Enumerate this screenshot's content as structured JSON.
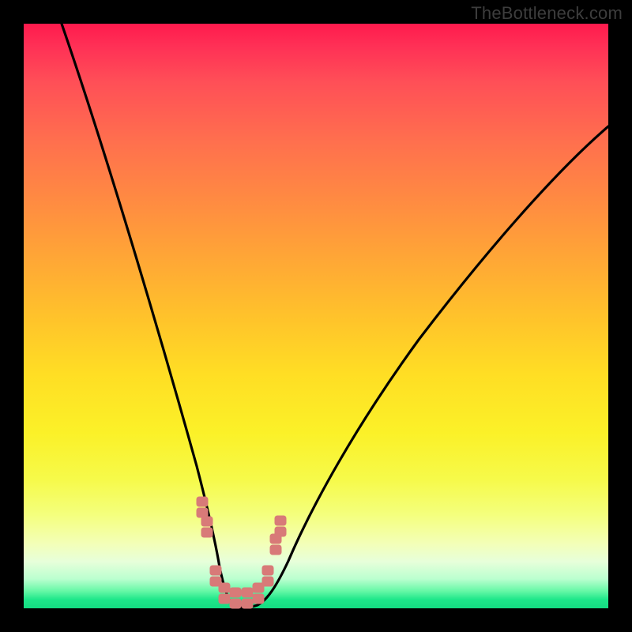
{
  "watermark": "TheBottleneck.com",
  "chart_data": {
    "type": "line",
    "title": "",
    "xlabel": "",
    "ylabel": "",
    "xlim": [
      0,
      100
    ],
    "ylim": [
      0,
      100
    ],
    "grid": false,
    "series": [
      {
        "name": "bottleneck-curve",
        "color": "#000000",
        "x": [
          6,
          10,
          15,
          20,
          25,
          28,
          30,
          32,
          34,
          35,
          36,
          38,
          40,
          43,
          47,
          55,
          65,
          75,
          85,
          95,
          100
        ],
        "y": [
          100,
          87,
          70,
          54,
          36,
          25,
          17,
          10,
          4,
          1,
          0,
          0,
          1,
          4,
          10,
          22,
          36,
          48,
          58,
          67,
          71
        ]
      },
      {
        "name": "optimal-zone-markers",
        "color": "#d87a78",
        "marker": "double-square",
        "x": [
          30,
          30.8,
          32,
          34,
          36,
          38,
          40,
          41.5,
          42.8,
          43.5
        ],
        "y": [
          17,
          13.5,
          4.2,
          1.2,
          0.5,
          0.5,
          1.2,
          4.2,
          10,
          13.5
        ]
      }
    ],
    "background_gradient": {
      "top_color": "#ff1a4d",
      "mid_color": "#ffde24",
      "bottom_color": "#14dc82"
    }
  }
}
